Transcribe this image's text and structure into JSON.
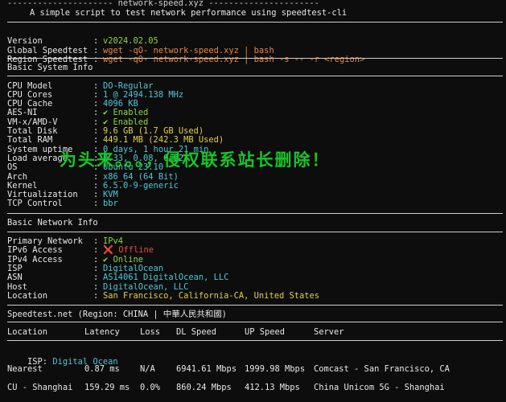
{
  "header": {
    "title_line": "--------------------- network-speed.xyz ----------------------",
    "subtitle": "A simple script to test network performance using speedtest-cli"
  },
  "meta": [
    {
      "label": "Version",
      "value": "v2024.02.05",
      "color": "green"
    },
    {
      "label": "Global Speedtest",
      "value": "wget -qO- network-speed.xyz | bash",
      "color": "orange"
    },
    {
      "label": "Region Speedtest",
      "value": "wget -qO- network-speed.xyz | bash -s -- -r <region>",
      "color": "orange"
    }
  ],
  "system": {
    "title": "Basic System Info",
    "rows": [
      {
        "label": "CPU Model",
        "value": "DO-Regular",
        "color": "cyan"
      },
      {
        "label": "CPU Cores",
        "value": "1 @ 2494.138 MHz",
        "color": "cyan"
      },
      {
        "label": "CPU Cache",
        "value": "4096 KB",
        "color": "cyan"
      },
      {
        "label": "AES-NI",
        "value": "✔ Enabled",
        "color": "green"
      },
      {
        "label": "VM-x/AMD-V",
        "value": "✔ Enabled",
        "color": "green"
      },
      {
        "label": "Total Disk",
        "value": "9.6 GB (1.7 GB Used)",
        "color": "yellow"
      },
      {
        "label": "Total RAM",
        "value": "449.1 MB (242.3 MB Used)",
        "color": "yellow"
      },
      {
        "label": "System uptime",
        "value": "0 days, 1 hour 21 min",
        "color": "cyan"
      },
      {
        "label": "Load average",
        "value": "0.33, 0.08, 0.02",
        "color": "cyan"
      },
      {
        "label": "OS",
        "value": "Ubuntu 23.10",
        "color": "cyan"
      },
      {
        "label": "Arch",
        "value": "x86_64 (64 Bit)",
        "color": "cyan"
      },
      {
        "label": "Kernel",
        "value": "6.5.0-9-generic",
        "color": "cyan"
      },
      {
        "label": "Virtualization",
        "value": "KVM",
        "color": "cyan"
      },
      {
        "label": "TCP Control",
        "value": "bbr",
        "color": "cyan"
      }
    ]
  },
  "network": {
    "title": "Basic Network Info",
    "rows": [
      {
        "label": "Primary Network",
        "value": "IPv4",
        "color": "green"
      },
      {
        "label": "IPv6 Access",
        "value": "❌ Offline",
        "color": "red"
      },
      {
        "label": "IPv4 Access",
        "value": "✔ Online",
        "color": "green"
      },
      {
        "label": "ISP",
        "value": "DigitalOcean",
        "color": "cyan"
      },
      {
        "label": "ASN",
        "value": "AS14061 DigitalOcean, LLC",
        "color": "cyan"
      },
      {
        "label": "Host",
        "value": "DigitalOcean, LLC",
        "color": "cyan"
      },
      {
        "label": "Location",
        "value": "San Francisco, California-CA, United States",
        "color": "yellow"
      }
    ]
  },
  "speedtest": {
    "title": "Speedtest.net (Region: CHINA | 中華人民共和國)",
    "columns": [
      "Location",
      "Latency",
      "Loss",
      "DL Speed",
      "UP Speed",
      "Server"
    ],
    "isp_label": "ISP:",
    "isp_value": "Digital Ocean",
    "rows": [
      {
        "location": "Nearest",
        "latency": "0.87 ms",
        "loss": "N/A",
        "dl": "6941.61 Mbps",
        "up": "1999.98 Mbps",
        "server": "Comcast - San Francisco, CA"
      },
      {
        "location": "CU - Shanghai",
        "latency": "159.29 ms",
        "loss": "0.0%",
        "dl": "860.24 Mbps",
        "up": "412.13 Mbps",
        "server": "China Unicom 5G - Shanghai"
      }
    ]
  },
  "watermark": "为头来。。。，侵权联系站长删除！",
  "colors": {
    "green": "#8bd448",
    "orange": "#e8863e",
    "cyan": "#4fc7d6",
    "yellow": "#e0d24a",
    "red": "#e84c3d",
    "background": "#0d0d0d"
  }
}
